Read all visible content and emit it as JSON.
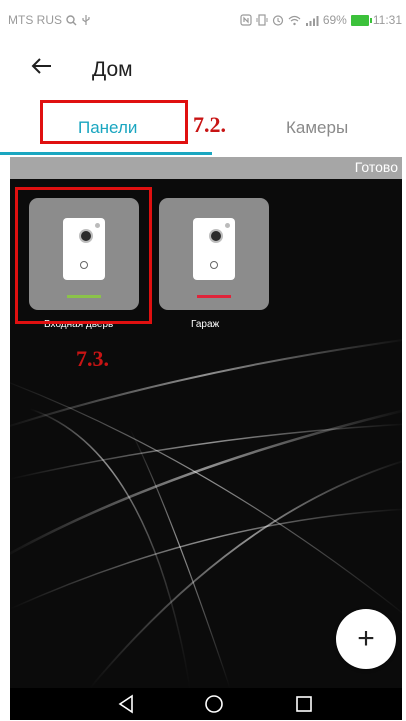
{
  "status_bar": {
    "carrier": "MTS RUS",
    "battery": "69%",
    "time": "11:31"
  },
  "header": {
    "title": "Дом"
  },
  "tabs": [
    {
      "label": "Панели",
      "active": true
    },
    {
      "label": "Камеры",
      "active": false
    }
  ],
  "annotations": {
    "tab_marker": "7.2.",
    "tile_marker": "7.3."
  },
  "edit_bar": {
    "done_label": "Готово"
  },
  "panels": [
    {
      "name": "Входная дверь",
      "status_color": "#8bc34a"
    },
    {
      "name": "Гараж",
      "status_color": "#e0243a"
    }
  ],
  "fab": {
    "label": "+"
  },
  "colors": {
    "accent": "#1aa6c0",
    "annotation_red": "#c81414"
  }
}
